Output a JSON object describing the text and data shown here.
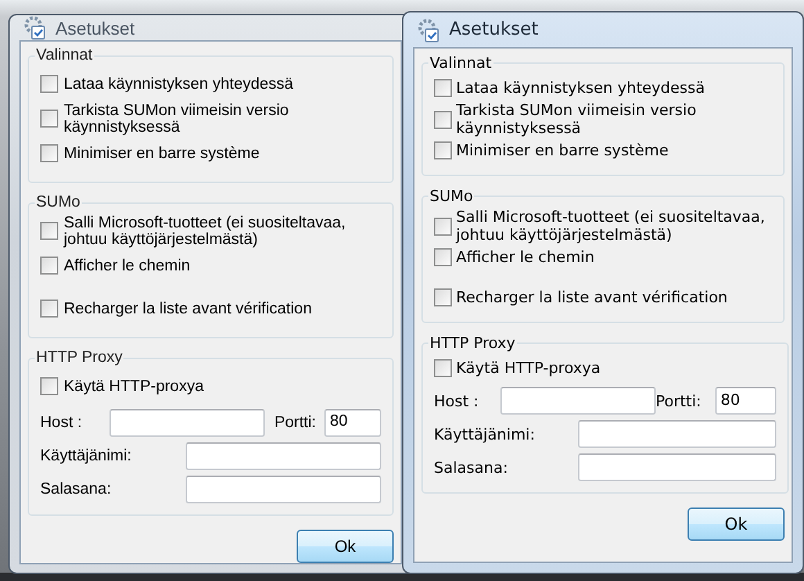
{
  "windows": [
    {
      "title": "Asetukset",
      "active": false,
      "groups": [
        {
          "title": "Valinnat",
          "options": [
            {
              "label": "Lataa käynnistyksen yhteydessä",
              "checked": false
            },
            {
              "label": "Tarkista SUMon viimeisin versio käynnistyksessä",
              "checked": false
            },
            {
              "label": "Minimiser en barre système",
              "checked": false
            }
          ]
        },
        {
          "title": "SUMo",
          "options": [
            {
              "label": "Salli Microsoft-tuotteet (ei suositeltavaa, johtuu käyttöjärjestelmästä)",
              "checked": false
            },
            {
              "label": "Afficher le chemin",
              "checked": false
            },
            {
              "label": "Recharger la liste avant vérification",
              "checked": false
            }
          ]
        },
        {
          "title": "HTTP Proxy",
          "options": [
            {
              "label": "Käytä HTTP-proxya",
              "checked": false
            }
          ],
          "proxy": {
            "host_label": "Host :",
            "port_label": "Portti:",
            "port_value": "80",
            "username_label": "Käyttäjänimi:",
            "password_label": "Salasana:"
          }
        }
      ],
      "button": "Ok"
    },
    {
      "title": "Asetukset",
      "active": true,
      "groups": [
        {
          "title": "Valinnat",
          "options": [
            {
              "label": "Lataa käynnistyksen yhteydessä",
              "checked": false
            },
            {
              "label": "Tarkista SUMon viimeisin versio käynnistyksessä",
              "checked": false
            },
            {
              "label": "Minimiser en barre système",
              "checked": false
            }
          ]
        },
        {
          "title": "SUMo",
          "options": [
            {
              "label": "Salli Microsoft-tuotteet (ei suositeltavaa, johtuu käyttöjärjestelmästä)",
              "checked": false
            },
            {
              "label": "Afficher le chemin",
              "checked": false
            },
            {
              "label": "Recharger la liste avant vérification",
              "checked": false
            }
          ]
        },
        {
          "title": "HTTP Proxy",
          "options": [
            {
              "label": "Käytä HTTP-proxya",
              "checked": false
            }
          ],
          "proxy": {
            "host_label": "Host :",
            "port_label": "Portti:",
            "port_value": "80",
            "username_label": "Käyttäjänimi:",
            "password_label": "Salasana:"
          }
        }
      ],
      "button": "Ok"
    }
  ]
}
